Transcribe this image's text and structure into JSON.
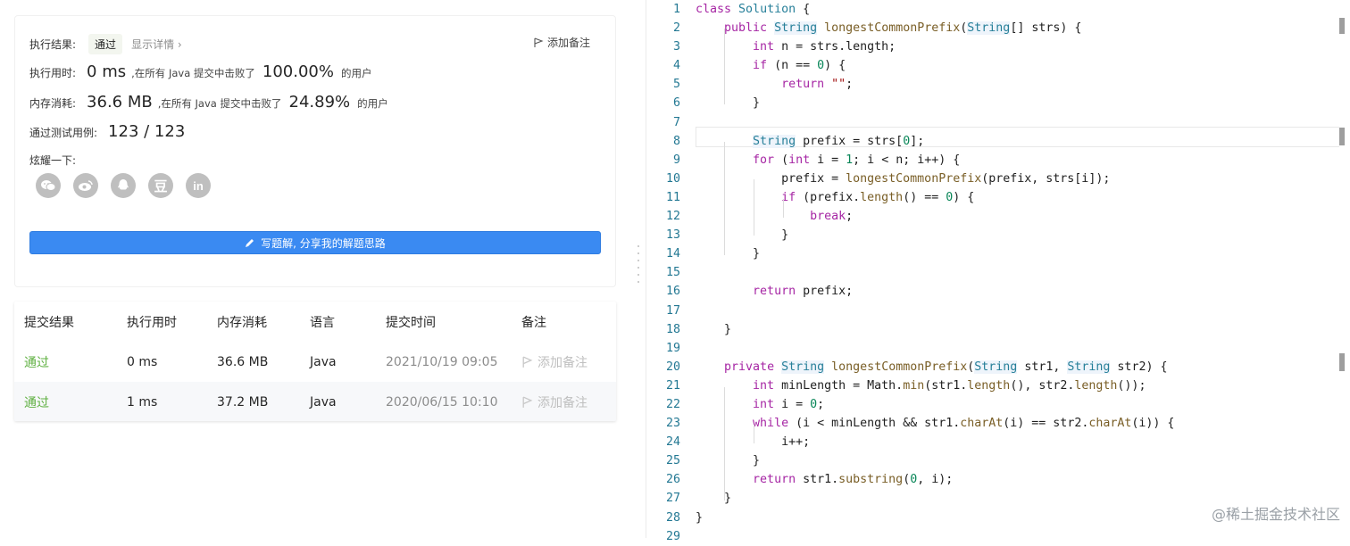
{
  "result_card": {
    "result_label": "执行结果:",
    "result_status": "通过",
    "details_link": "显示详情 ›",
    "add_note_label": "添加备注",
    "runtime_label": "执行用时:",
    "runtime_value": "0 ms",
    "runtime_mid": ",在所有 Java 提交中击败了",
    "runtime_percent": "100.00%",
    "runtime_suffix": "的用户",
    "memory_label": "内存消耗:",
    "memory_value": "36.6 MB",
    "memory_mid": ",在所有 Java 提交中击败了",
    "memory_percent": "24.89%",
    "memory_suffix": "的用户",
    "tests_label": "通过测试用例:",
    "tests_value": "123 / 123",
    "share_label": "炫耀一下:",
    "share_icons": [
      "wechat-icon",
      "weibo-icon",
      "qq-icon",
      "douban-icon",
      "linkedin-icon"
    ],
    "write_solution_label": "写题解, 分享我的解题思路"
  },
  "submissions": {
    "headers": [
      "提交结果",
      "执行用时",
      "内存消耗",
      "语言",
      "提交时间",
      "备注"
    ],
    "rows": [
      {
        "status": "通过",
        "runtime": "0 ms",
        "memory": "36.6 MB",
        "language": "Java",
        "time": "2021/10/19 09:05",
        "note": "添加备注"
      },
      {
        "status": "通过",
        "runtime": "1 ms",
        "memory": "37.2 MB",
        "language": "Java",
        "time": "2020/06/15 10:10",
        "note": "添加备注"
      }
    ]
  },
  "editor": {
    "line_numbers": [
      "1",
      "2",
      "3",
      "4",
      "5",
      "6",
      "7",
      "8",
      "9",
      "10",
      "11",
      "12",
      "13",
      "14",
      "15",
      "16",
      "17",
      "18",
      "19",
      "20",
      "21",
      "22",
      "23",
      "24",
      "25",
      "26",
      "27",
      "28",
      "29"
    ],
    "code_lines": [
      "class Solution {",
      "    public String longestCommonPrefix(String[] strs) {",
      "        int n = strs.length;",
      "        if (n == 0) {",
      "            return \"\";",
      "        }",
      "",
      "        String prefix = strs[0];",
      "        for (int i = 1; i < n; i++) {",
      "            prefix = longestCommonPrefix(prefix, strs[i]);",
      "            if (prefix.length() == 0) {",
      "                break;",
      "            }",
      "        }",
      "",
      "        return prefix;",
      "",
      "    }",
      "",
      "    private String longestCommonPrefix(String str1, String str2) {",
      "        int minLength = Math.min(str1.length(), str2.length());",
      "        int i = 0;",
      "        while (i < minLength && str1.charAt(i) == str2.charAt(i)) {",
      "            i++;",
      "        }",
      "        return str1.substring(0, i);",
      "    }",
      "}",
      ""
    ]
  },
  "watermark": "@稀土掘金技术社区",
  "colors": {
    "accent_blue": "#3a8af2",
    "pass_green": "#5fb041",
    "keyword": "#a626a4",
    "type": "#267f99",
    "function": "#795e26",
    "number": "#098658",
    "line_number": "#237893"
  }
}
